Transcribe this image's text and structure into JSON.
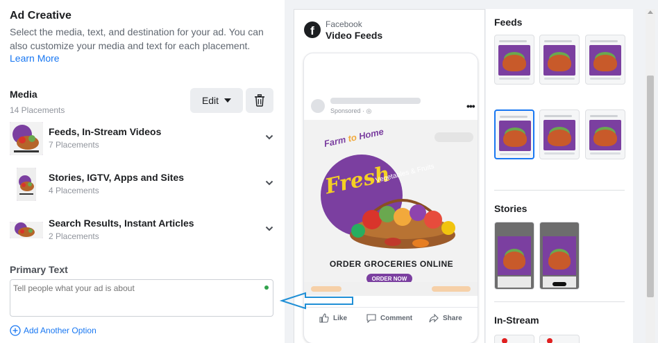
{
  "left": {
    "title": "Ad Creative",
    "description": "Select the media, text, and destination for your ad. You can also customize your media and text for each placement.",
    "learn_more": "Learn More",
    "media": {
      "label": "Media",
      "subtitle": "14 Placements",
      "edit_label": "Edit",
      "placements": [
        {
          "name": "Feeds, In-Stream Videos",
          "count": "7 Placements"
        },
        {
          "name": "Stories, IGTV, Apps and Sites",
          "count": "4 Placements"
        },
        {
          "name": "Search Results, Instant Articles",
          "count": "2 Placements"
        }
      ]
    },
    "primary_text": {
      "label": "Primary Text",
      "placeholder": "Tell people what your ad is about"
    },
    "add_option": "Add Another Option"
  },
  "preview": {
    "platform": "Facebook",
    "placement": "Video Feeds",
    "sponsored": "Sponsored · ",
    "creative": {
      "tagline_a": "Farm ",
      "tagline_to": "to",
      "tagline_b": " Home",
      "brand": "Fresh",
      "sub": "Vegetables & Fruits",
      "headline": "ORDER GROCERIES ONLINE",
      "cta": "ORDER NOW"
    },
    "actions": {
      "like": "Like",
      "comment": "Comment",
      "share": "Share"
    }
  },
  "placements_panel": {
    "feeds": "Feeds",
    "stories": "Stories",
    "instream": "In-Stream"
  },
  "colors": {
    "accent": "#1877f2",
    "brand_purple": "#7b3fa0",
    "status_green": "#31a24c"
  }
}
